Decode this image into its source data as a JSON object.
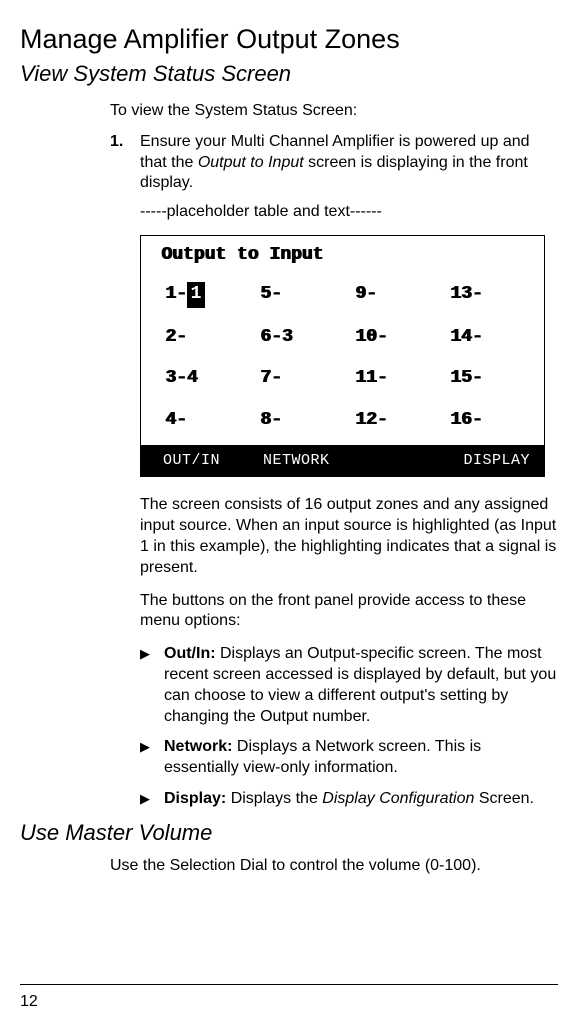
{
  "title": "Manage Amplifier Output Zones",
  "subtitle": "View System Status Screen",
  "intro": "To view the System Status Screen:",
  "step1": {
    "num": "1.",
    "text_a": "Ensure your Multi Channel Amplifier is powered up and that the ",
    "ital": "Output to Input",
    "text_b": " screen is displaying in the front display."
  },
  "placeholder": "-----placeholder table and text------",
  "lcd": {
    "header": "Output to Input",
    "rows": [
      {
        "c1a": "1-",
        "c1b": "1",
        "c1_hl": true,
        "c2": "5-",
        "c3": "9-",
        "c4": "13-"
      },
      {
        "c1a": "2-",
        "c1b": "",
        "c1_hl": false,
        "c2": "6-3",
        "c3": "10-",
        "c4": "14-"
      },
      {
        "c1a": "3-4",
        "c1b": "",
        "c1_hl": false,
        "c2": "7-",
        "c3": "11-",
        "c4": "15-"
      },
      {
        "c1a": "4-",
        "c1b": "",
        "c1_hl": false,
        "c2": "8-",
        "c3": "12-",
        "c4": "16-"
      }
    ],
    "footer": {
      "a": "OUT/IN",
      "b": "NETWORK",
      "c": "DISPLAY"
    }
  },
  "para1": "The screen consists of 16 output zones and any assigned input source. When an input source is highlighted (as Input 1 in this example), the highlighting indicates that a signal is present.",
  "para2": "The buttons on the front panel provide access to these menu options:",
  "bullets": [
    {
      "lead": "Out/In:",
      "text": " Displays an Output-specific screen. The most recent screen accessed is displayed by default, but you can choose to view a different output's setting by changing the Output number."
    },
    {
      "lead": "Network:",
      "text": " Displays a Network screen. This is essentially view-only information."
    },
    {
      "lead": "Display:",
      "text_a": " Displays the ",
      "ital": "Display Configuration",
      "text_b": " Screen."
    }
  ],
  "section2": "Use Master Volume",
  "para3": "Use the Selection Dial to control the volume (0-100).",
  "page_number": "12",
  "glyphs": {
    "triangle": "▶"
  }
}
